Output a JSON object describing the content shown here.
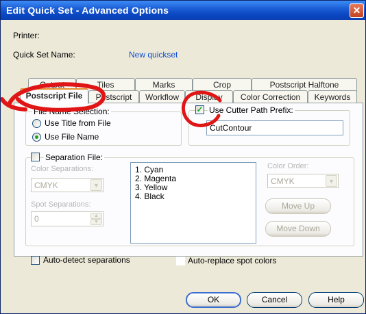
{
  "window": {
    "title": "Edit Quick Set - Advanced Options",
    "close_glyph": "✕"
  },
  "header": {
    "printer_label": "Printer:",
    "quickset_label": "Quick Set Name:",
    "quickset_value": "New quickset"
  },
  "tabs_back": [
    {
      "label": "Output"
    },
    {
      "label": "Tiles"
    },
    {
      "label": "Marks"
    },
    {
      "label": "Crop"
    },
    {
      "label": "Postscript Halftone"
    }
  ],
  "tabs_front": [
    {
      "label": "Postscript File"
    },
    {
      "label": "Postscript"
    },
    {
      "label": "Workflow"
    },
    {
      "label": "Display"
    },
    {
      "label": "Color Correction"
    },
    {
      "label": "Keywords"
    }
  ],
  "file_name_selection": {
    "legend": "File Name Selection:",
    "option_title": "Use Title from File",
    "option_name": "Use File Name"
  },
  "cutter": {
    "label": "Use Cutter Path Prefix:",
    "value": "CutContour"
  },
  "separation": {
    "label": "Separation File:",
    "color_separations_label": "Color Separations:",
    "color_separations_value": "CMYK",
    "spot_separations_label": "Spot Separations:",
    "spot_separations_value": "0",
    "inks": [
      "1. Cyan",
      "2. Magenta",
      "3. Yellow",
      "4. Black"
    ],
    "color_order_label": "Color Order:",
    "color_order_value": "CMYK",
    "move_up": "Move Up",
    "move_down": "Move Down"
  },
  "options": {
    "auto_detect": "Auto-detect separations",
    "auto_replace": "Auto-replace spot colors"
  },
  "footer": {
    "ok": "OK",
    "cancel": "Cancel",
    "help": "Help"
  },
  "colors": {
    "accent_title": "#0b48c4",
    "annotation_red": "#e01515"
  }
}
